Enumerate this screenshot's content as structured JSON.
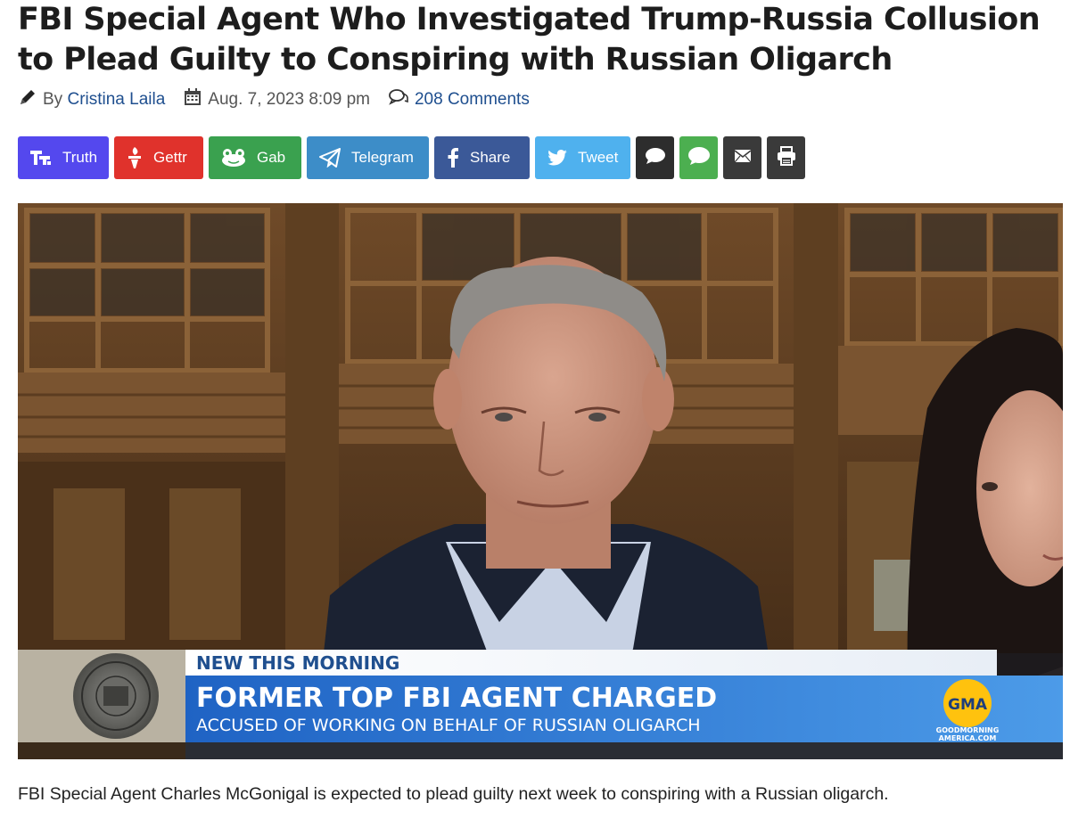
{
  "article": {
    "headline": "FBI Special Agent Who Investigated Trump-Russia Collusion to Plead Guilty to Conspiring with Russian Oligarch",
    "by_label": "By",
    "author": "Cristina Laila",
    "date": "Aug. 7, 2023 8:09 pm",
    "comments": "208 Comments"
  },
  "share_buttons": [
    {
      "label": "Truth",
      "icon": "truth-social-icon",
      "color": "#5448ee"
    },
    {
      "label": "Gettr",
      "icon": "gettr-icon",
      "color": "#e0322c"
    },
    {
      "label": "Gab",
      "icon": "gab-frog-icon",
      "color": "#3aa14f"
    },
    {
      "label": "Telegram",
      "icon": "telegram-icon",
      "color": "#3d8dc8"
    },
    {
      "label": "Share",
      "icon": "facebook-icon",
      "color": "#3b5998"
    },
    {
      "label": "Tweet",
      "icon": "twitter-icon",
      "color": "#4fb1ee"
    }
  ],
  "icon_buttons": [
    {
      "icon": "speech-bubble-icon",
      "color": "#2d2d2d"
    },
    {
      "icon": "sms-icon",
      "color": "#4caf50",
      "text": "SMS"
    },
    {
      "icon": "email-icon",
      "color": "#3a3a3a"
    },
    {
      "icon": "print-icon",
      "color": "#3a3a3a"
    }
  ],
  "hero": {
    "lower_third_top": "NEW THIS MORNING",
    "lower_third_headline": "FORMER TOP FBI AGENT CHARGED",
    "lower_third_sub": "ACCUSED OF WORKING ON BEHALF OF RUSSIAN OLIGARCH",
    "logo": "GMA",
    "logo_sub1": "GOODMORNING",
    "logo_sub2": "AMERICA.COM"
  },
  "caption": "FBI Special Agent Charles McGonigal is expected to plead guilty next week to conspiring with a Russian oligarch."
}
